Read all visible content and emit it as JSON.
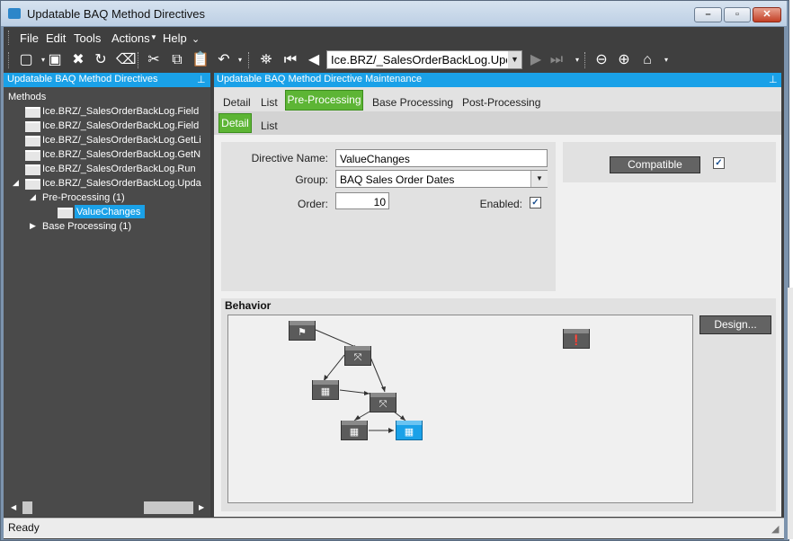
{
  "window": {
    "title": "Updatable BAQ Method Directives"
  },
  "menu": [
    "File",
    "Edit",
    "Tools",
    "Actions",
    "Help"
  ],
  "toolbar": {
    "nav_value": "Ice.BRZ/_SalesOrderBackLog.Upda",
    "icons": [
      "new-icon",
      "save-icon",
      "delete-icon",
      "refresh-icon",
      "clear-icon",
      "cut-icon",
      "copy-icon",
      "paste-icon",
      "undo-icon",
      "search-icon",
      "first-record-icon",
      "previous-record-icon",
      "next-record-icon",
      "last-record-icon",
      "back-icon",
      "forward-icon",
      "home-icon"
    ]
  },
  "left_panel": {
    "title": "Updatable BAQ Method Directives",
    "root_label": "Methods",
    "methods": [
      "Ice.BRZ/_SalesOrderBackLog.Field",
      "Ice.BRZ/_SalesOrderBackLog.Field",
      "Ice.BRZ/_SalesOrderBackLog.GetLi",
      "Ice.BRZ/_SalesOrderBackLog.GetN",
      "Ice.BRZ/_SalesOrderBackLog.Run",
      "Ice.BRZ/_SalesOrderBackLog.Upda"
    ],
    "pre_processing": "Pre-Processing (1)",
    "selected_directive": "ValueChanges",
    "base_processing": "Base Processing (1)"
  },
  "right_panel": {
    "title": "Updatable BAQ Method Directive Maintenance",
    "tabs": [
      "Detail",
      "List",
      "Pre-Processing",
      "Base Processing",
      "Post-Processing"
    ],
    "subtabs": [
      "Detail",
      "List"
    ]
  },
  "form": {
    "directive_name_label": "Directive Name:",
    "directive_name": "ValueChanges",
    "group_label": "Group:",
    "group": "BAQ Sales Order Dates",
    "order_label": "Order:",
    "order": "10",
    "enabled_label": "Enabled:",
    "enabled": true,
    "compatible_button": "Compatible",
    "compatible_checked": true
  },
  "behavior": {
    "label": "Behavior",
    "design_button": "Design..."
  },
  "status": {
    "text": "Ready"
  }
}
